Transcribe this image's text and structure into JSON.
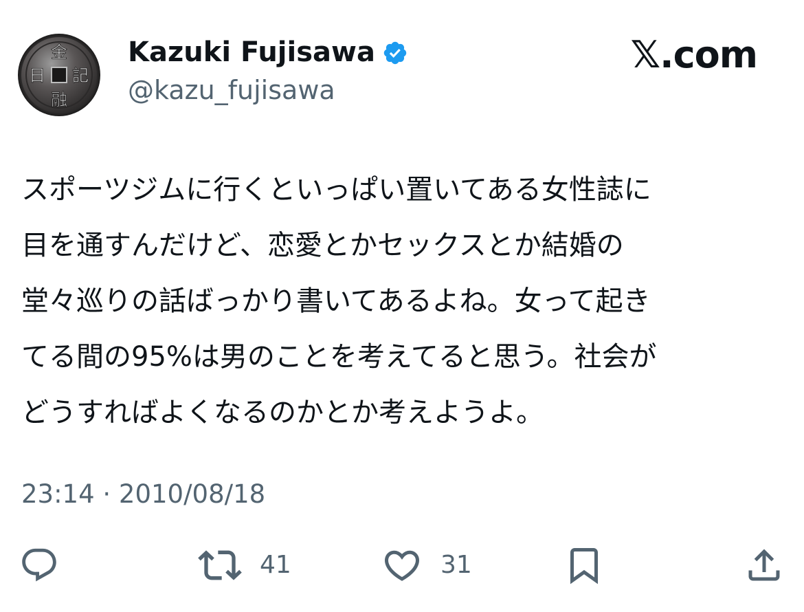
{
  "author": {
    "display_name": "Kazuki Fujisawa",
    "handle": "@kazu_fujisawa",
    "verified": true,
    "avatar_icon": "coin-avatar",
    "avatar_characters": [
      "金",
      "記",
      "融",
      "日"
    ]
  },
  "brand": {
    "label": "𝕏.com"
  },
  "tweet": {
    "lines": [
      "スポーツジムに行くといっぱい置いてある女性誌に",
      "目を通すんだけど、恋愛とかセックスとか結婚の",
      "堂々巡りの話ばっかり書いてあるよね。女って起き",
      "てる間の95%は男のことを考えてると思う。社会が",
      "どうすればよくなるのかとか考えようよ。"
    ],
    "timestamp": "23:14 · 2010/08/18"
  },
  "actions": {
    "reply": {
      "icon": "reply-icon"
    },
    "retweet": {
      "icon": "retweet-icon",
      "count": "41"
    },
    "like": {
      "icon": "heart-icon",
      "count": "31"
    },
    "bookmark": {
      "icon": "bookmark-icon"
    },
    "share": {
      "icon": "share-icon"
    }
  },
  "colors": {
    "text": "#0f1419",
    "secondary": "#536471",
    "verified": "#1d9bf0"
  }
}
